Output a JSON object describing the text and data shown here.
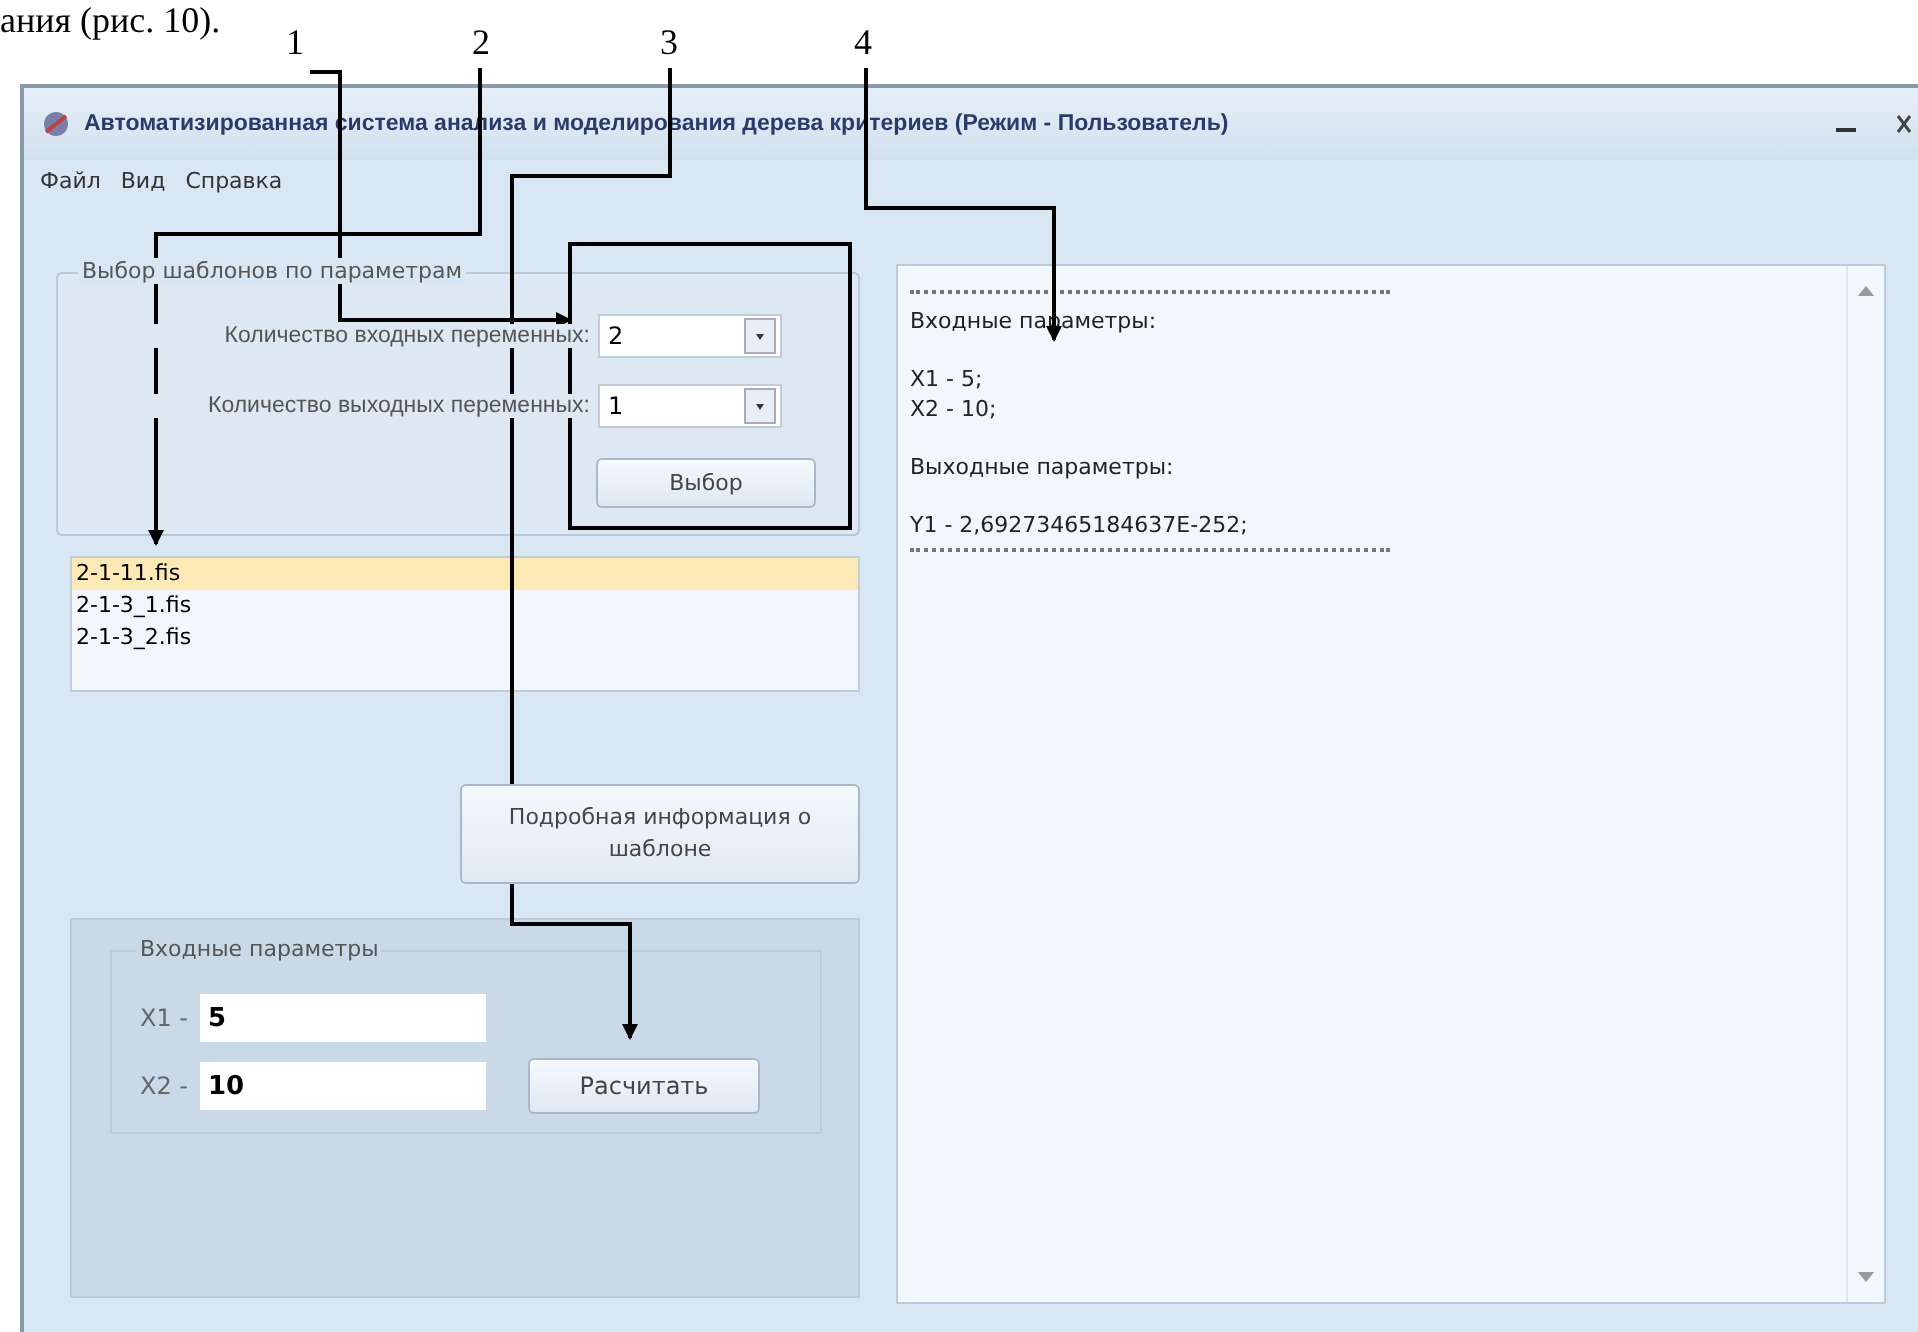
{
  "document_text": "ания (рис. 10).",
  "callouts": [
    "1",
    "2",
    "3",
    "4"
  ],
  "window": {
    "title": "Автоматизированная система анализа и моделирования дерева критериев (Режим - Пользователь)"
  },
  "menu": [
    "Файл",
    "Вид",
    "Справка"
  ],
  "template_group": {
    "title": "Выбор шаблонов по параметрам",
    "inputs_label": "Количество входных переменных:",
    "inputs_value": "2",
    "outputs_label": "Количество выходных переменных:",
    "outputs_value": "1",
    "button": "Выбор"
  },
  "templates": [
    {
      "name": "2-1-11.fis",
      "selected": true
    },
    {
      "name": "2-1-3_1.fis",
      "selected": false
    },
    {
      "name": "2-1-3_2.fis",
      "selected": false
    }
  ],
  "details_button": "Подробная информация о шаблоне",
  "input_group": {
    "title": "Входные параметры",
    "fields": [
      {
        "label": "X1 -",
        "value": "5"
      },
      {
        "label": "X2 -",
        "value": "10"
      }
    ],
    "button": "Расчитать"
  },
  "output_lines": [
    {
      "kind": "rule"
    },
    {
      "kind": "text",
      "text": "Входные параметры:"
    },
    {
      "kind": "gap"
    },
    {
      "kind": "text",
      "text": "X1 - 5;"
    },
    {
      "kind": "text",
      "text": "X2 - 10;"
    },
    {
      "kind": "gap"
    },
    {
      "kind": "text",
      "text": "Выходные параметры:"
    },
    {
      "kind": "gap"
    },
    {
      "kind": "text",
      "text": "Y1 - 2,69273465184637E-252;"
    },
    {
      "kind": "rule"
    }
  ]
}
